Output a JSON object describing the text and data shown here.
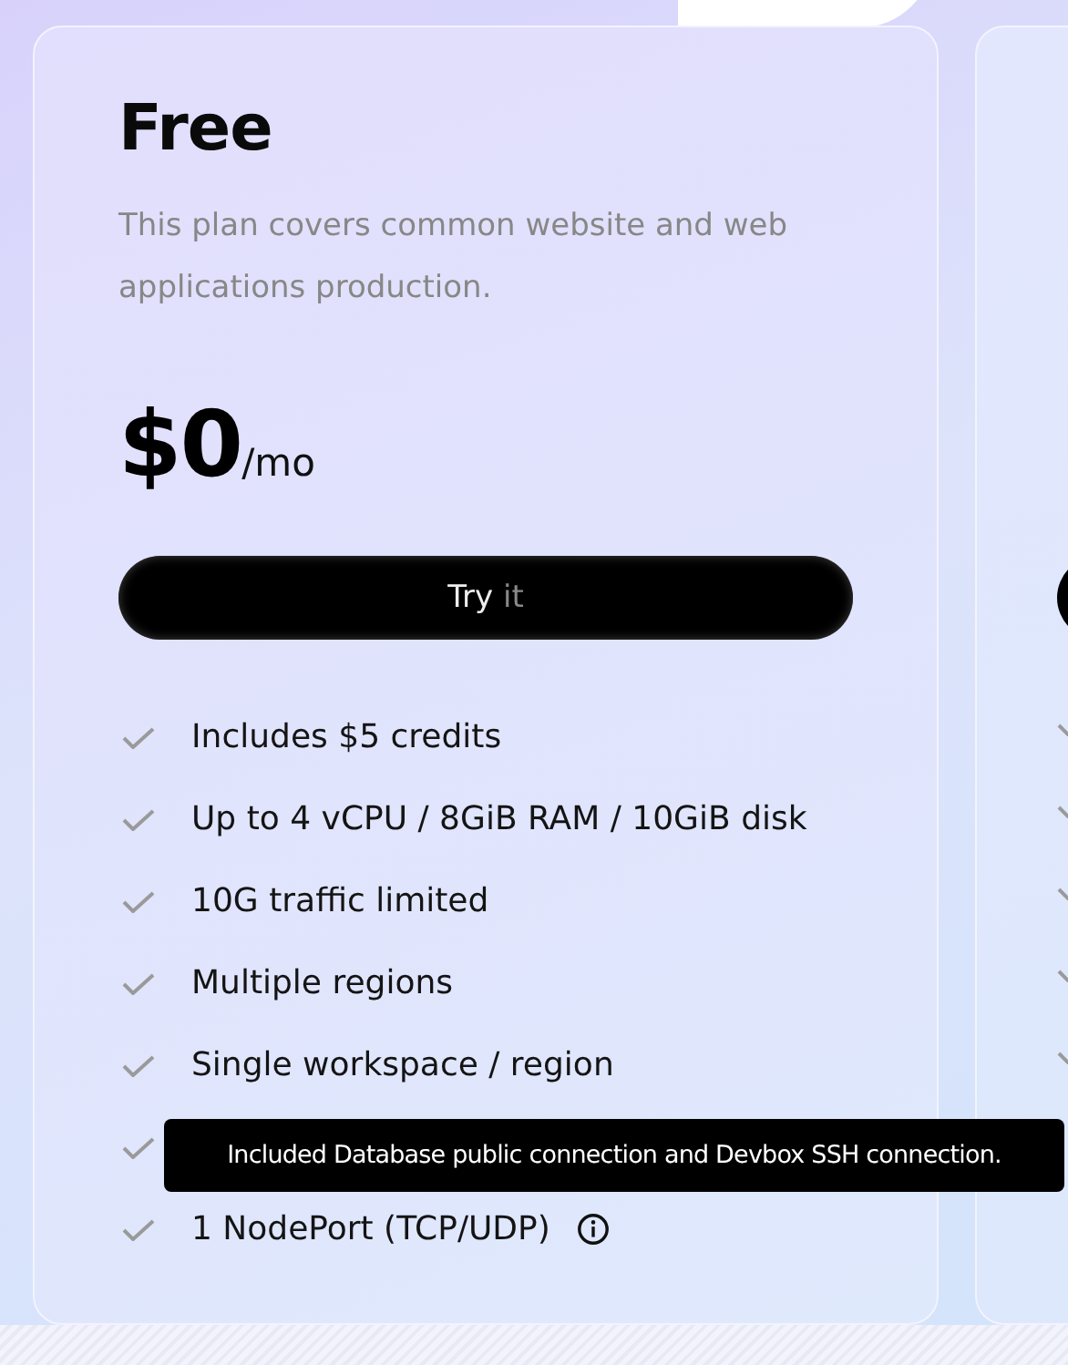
{
  "plan": {
    "name": "Free",
    "description": "This plan covers common website and web applications production.",
    "price": "$0",
    "period": "/mo",
    "button": {
      "label": "Try",
      "label_dim": "it"
    },
    "features": [
      {
        "label": "Includes $5 credits",
        "info": false
      },
      {
        "label": "Up to 4 vCPU / 8GiB RAM / 10GiB disk",
        "info": false
      },
      {
        "label": "10G traffic limited",
        "info": false
      },
      {
        "label": "Multiple regions",
        "info": false
      },
      {
        "label": "Single workspace / region",
        "info": false
      },
      {
        "info": false
      },
      {
        "label": "1 NodePort (TCP/UDP)",
        "info": true
      }
    ]
  },
  "tooltip": "Included Database public connection and Devbox SSH connection."
}
